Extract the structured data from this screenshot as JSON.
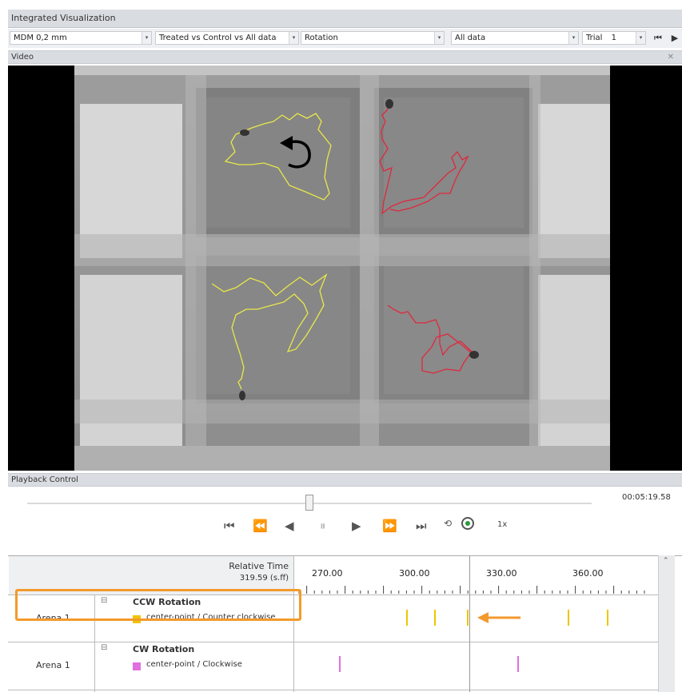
{
  "window": {
    "title": "Integrated Visualization"
  },
  "toolbar": {
    "measure": "MDM 0,2 mm",
    "group": "Treated vs Control vs All data",
    "variable": "Rotation",
    "filter": "All data",
    "trial_label": "Trial",
    "trial_value": "1"
  },
  "video_panel": {
    "title": "Video"
  },
  "playback": {
    "title": "Playback Control",
    "time": "00:05:19.58",
    "speed": "1x",
    "position_fraction": 0.5
  },
  "timeline": {
    "header": {
      "label": "Relative Time",
      "value": "319.59 (s.ff)"
    },
    "ticks": [
      "270.00",
      "300.00",
      "330.00",
      "360.00"
    ],
    "rows": [
      {
        "arena": "Arena 1",
        "group": "CCW Rotation",
        "series": "center-point / Counter clockwise",
        "color": "#f0c400"
      },
      {
        "arena": "Arena 1",
        "group": "CW Rotation",
        "series": "center-point / Clockwise",
        "color": "#e070e0"
      }
    ]
  },
  "colors": {
    "highlight": "#f39a2c",
    "track_left": "#e8e84a",
    "track_right": "#e0283c"
  },
  "icons": [
    "rotation-arrow-icon",
    "arrow-left-icon",
    "skip-start-icon",
    "step-back-fast-icon",
    "step-back-icon",
    "pause-icon",
    "play-icon",
    "step-forward-icon",
    "skip-end-icon",
    "record-icon",
    "close-icon"
  ]
}
